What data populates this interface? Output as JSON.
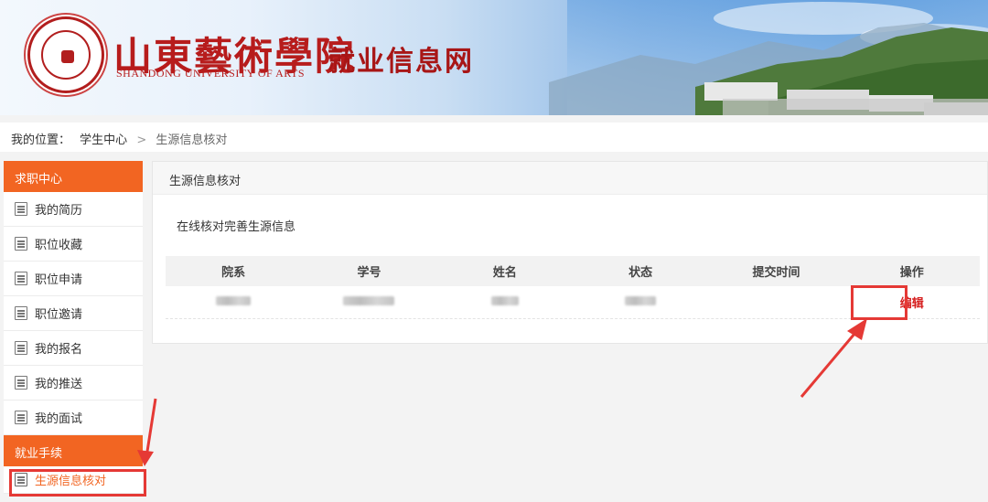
{
  "banner": {
    "school_name_cn": "山東藝術學院",
    "school_name_en": "SHANDONG UNIVERSITY OF ARTS",
    "site_name": "就业信息网"
  },
  "breadcrumb": {
    "prefix": "我的位置：",
    "items": [
      "学生中心",
      "生源信息核对"
    ],
    "separator": ">"
  },
  "sidebar": {
    "section1": {
      "title": "求职中心",
      "items": [
        "我的简历",
        "职位收藏",
        "职位申请",
        "职位邀请",
        "我的报名",
        "我的推送",
        "我的面试"
      ]
    },
    "section2": {
      "title": "就业手续",
      "items": [
        "生源信息核对"
      ]
    },
    "active_item": "生源信息核对",
    "item_icon": "document-list-icon"
  },
  "main": {
    "panel_title": "生源信息核对",
    "description": "在线核对完善生源信息",
    "table": {
      "headers": [
        "院系",
        "学号",
        "姓名",
        "状态",
        "提交时间",
        "操作"
      ],
      "rows": [
        {
          "action": "编辑"
        }
      ]
    }
  },
  "colors": {
    "accent": "#f26522",
    "brand_red": "#b71c1c",
    "annotation_red": "#e53935",
    "link_red": "#d62020"
  }
}
